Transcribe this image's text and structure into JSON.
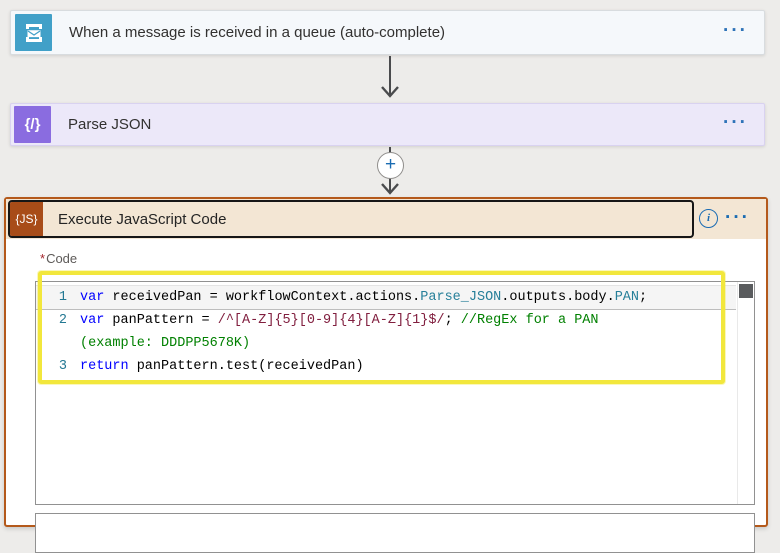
{
  "trigger_card": {
    "title": "When a message is received in a queue (auto-complete)",
    "icon": "service-bus-queue-icon",
    "menu": "···"
  },
  "parse_json_card": {
    "title": "Parse JSON",
    "icon_glyph": "{/}",
    "menu": "···"
  },
  "add_step": {
    "plus": "+"
  },
  "execute_js_card": {
    "title": "Execute JavaScript Code",
    "icon_glyph": "{JS}",
    "info": "i",
    "menu": "···",
    "code_field": {
      "required_marker": "*",
      "label": "Code",
      "rows": [
        {
          "num": "1",
          "current": true,
          "segments": [
            {
              "text": "var",
              "token": "keyword"
            },
            {
              "text": " receivedPan = workflowContext.actions.",
              "token": "plain"
            },
            {
              "text": "Parse_JSON",
              "token": "type"
            },
            {
              "text": ".outputs.body.",
              "token": "plain"
            },
            {
              "text": "PAN",
              "token": "type"
            },
            {
              "text": ";",
              "token": "plain"
            }
          ]
        },
        {
          "num": "2",
          "segments": [
            {
              "text": "var",
              "token": "keyword"
            },
            {
              "text": " panPattern = ",
              "token": "plain"
            },
            {
              "text": "/^[A-Z]{5}[0-9]{4}[A-Z]{1}$/",
              "token": "regexp"
            },
            {
              "text": "; ",
              "token": "plain"
            },
            {
              "text": "//RegEx for a PAN",
              "token": "comment"
            }
          ]
        },
        {
          "num": "",
          "segments": [
            {
              "text": "(example: DDDPP5678K)",
              "token": "comment"
            }
          ]
        },
        {
          "num": "3",
          "segments": [
            {
              "text": "return",
              "token": "keyword"
            },
            {
              "text": " panPattern.test(receivedPan)",
              "token": "plain"
            }
          ]
        }
      ]
    }
  },
  "colors": {
    "trigger_icon_bg": "#41a0c8",
    "parse_icon_bg": "#8a6ce0",
    "js_icon_bg": "#a84c18",
    "js_card_border": "#b4591b",
    "js_header_bg": "#f3e6d4",
    "annotation_yellow": "#f2e73c",
    "token_keyword": "#0000ff",
    "token_type": "#267f99",
    "token_regexp": "#811f3f",
    "token_comment": "#008000",
    "line_number": "#237893",
    "menu_blue": "#2e73b8"
  }
}
